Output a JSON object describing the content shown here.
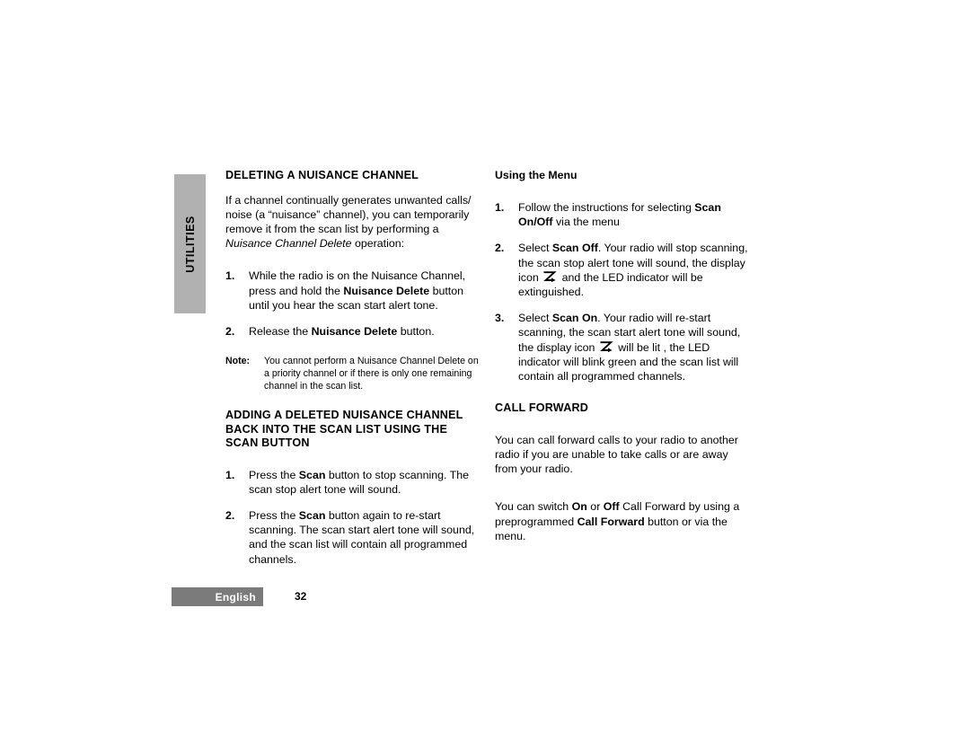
{
  "side_tab": {
    "label": "UTILITIES"
  },
  "footer": {
    "language": "English",
    "page_number": "32"
  },
  "icons": {
    "scan": "scan-z-arrow-icon"
  },
  "left_column": {
    "heading": "DELETING A NUISANCE CHANNEL",
    "intro_part1": "If a channel continually generates unwanted calls/ noise (a “nuisance” channel), you can temporarily remove it from the scan list by performing a ",
    "intro_italic": "Nuisance Channel Delete",
    "intro_part2": " operation:",
    "steps": [
      {
        "num": "1.",
        "part1": "While the radio is on the Nuisance Channel, press and hold the ",
        "bold1": "Nuisance Delete",
        "part2": " button until you hear the scan start alert tone."
      },
      {
        "num": "2.",
        "part1": "Release the ",
        "bold1": "Nuisance Delete",
        "part2": " button."
      }
    ],
    "note": {
      "label": "Note:",
      "text": "You cannot perform a Nuisance Channel Delete on a priority channel or if there is only one remaining channel in the scan list."
    },
    "heading2": "ADDING A DELETED NUISANCE CHANNEL BACK INTO THE SCAN LIST USING THE SCAN BUTTON",
    "steps2": [
      {
        "num": "1.",
        "part1": "Press the ",
        "bold1": "Scan",
        "part2": " button to stop scanning. The scan stop alert tone will sound."
      },
      {
        "num": "2.",
        "part1": "Press the ",
        "bold1": "Scan",
        "part2": " button again to re-start scanning. The scan start alert tone will sound, and the scan list will contain all programmed channels."
      }
    ]
  },
  "right_column": {
    "subheading": "Using the Menu",
    "steps": [
      {
        "num": "1.",
        "part1": "Follow the instructions for selecting ",
        "bold1": "Scan On/Off",
        "part2": " via the menu"
      },
      {
        "num": "2.",
        "part1": "Select ",
        "bold1": "Scan Off",
        "part2": ". Your radio will stop scanning, the scan stop alert tone  will sound, the display icon ",
        "part3": " and the LED indicator will be extinguished."
      },
      {
        "num": "3.",
        "part1": "Select ",
        "bold1": "Scan On",
        "part2": ". Your radio will re-start scanning, the scan start alert tone  will sound, the display icon ",
        "part3": " will be lit , the LED indicator will blink green and the scan list will contain all programmed channels."
      }
    ],
    "heading": "CALL FORWARD",
    "para1": "You can call forward calls to your radio to another radio if you are unable to take calls or are away from your radio.",
    "para2_part1": "You can switch ",
    "para2_bold1": "On",
    "para2_part2": " or ",
    "para2_bold2": "Off",
    "para2_part3": " Call Forward by using a preprogrammed ",
    "para2_bold3": "Call Forward",
    "para2_part4": " button or via the menu."
  }
}
